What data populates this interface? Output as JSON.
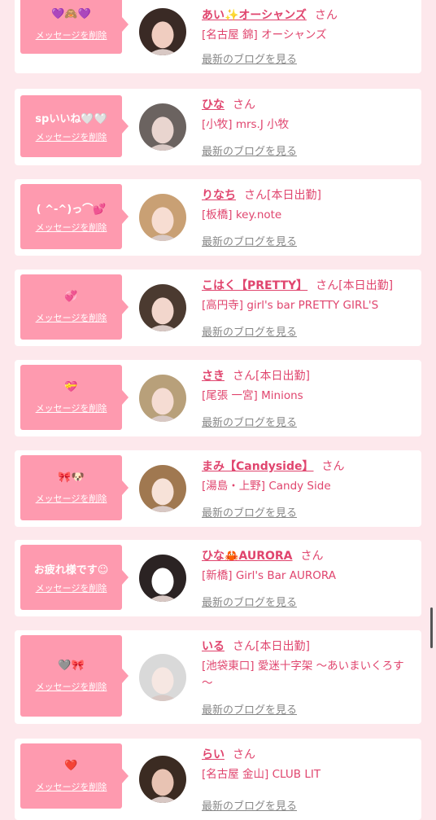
{
  "delete_label": "メッセージを削除",
  "san_label": "さん",
  "blog_label": "最新のブログを見る",
  "colors": {
    "bubble": "#fe9aaf",
    "accent": "#e0456e",
    "background": "#fde8ec",
    "card": "#ffffff"
  },
  "items": [
    {
      "message": "💜🙈💜",
      "name": "あい✨オーシャンズ",
      "status": "",
      "shop": "[名古屋 錦] オーシャンズ",
      "avatar_icon": "girl-avatar"
    },
    {
      "message": "spいいね🤍🤍",
      "name": "ひな",
      "status": "",
      "shop": "[小牧] mrs.J 小牧",
      "avatar_icon": "girl-avatar"
    },
    {
      "message": "( ^-^)っ⌒💕",
      "name": "りなち",
      "status": "[本日出勤]",
      "shop": "[板橋] key.note",
      "avatar_icon": "girl-avatar"
    },
    {
      "message": "💞",
      "name": "こはく【PRETTY】",
      "status": "[本日出勤]",
      "shop": "[高円寺] girl's bar PRETTY GIRL'S",
      "avatar_icon": "girl-avatar"
    },
    {
      "message": "💝",
      "name": "さき",
      "status": "[本日出勤]",
      "shop": "[尾張 一宮] Minions",
      "avatar_icon": "girl-avatar"
    },
    {
      "message": "🎀🐶",
      "name": "まみ【Candyside】",
      "status": "",
      "shop": "[湯島・上野] Candy Side",
      "avatar_icon": "girl-avatar"
    },
    {
      "message": "お疲れ様です☺",
      "name": "ひな🦀AURORA",
      "status": "",
      "shop": "[新橋] Girl's Bar AURORA",
      "avatar_icon": "girl-avatar"
    },
    {
      "message": "🩶🎀",
      "name": "いる",
      "status": "[本日出勤]",
      "shop": "[池袋東口] 愛迷十字架 ～あいまいくろす～",
      "avatar_icon": "girl-avatar"
    },
    {
      "message": "❤️",
      "name": "らい",
      "status": "",
      "shop": "[名古屋 金山] CLUB LIT",
      "avatar_icon": "girl-avatar"
    }
  ]
}
